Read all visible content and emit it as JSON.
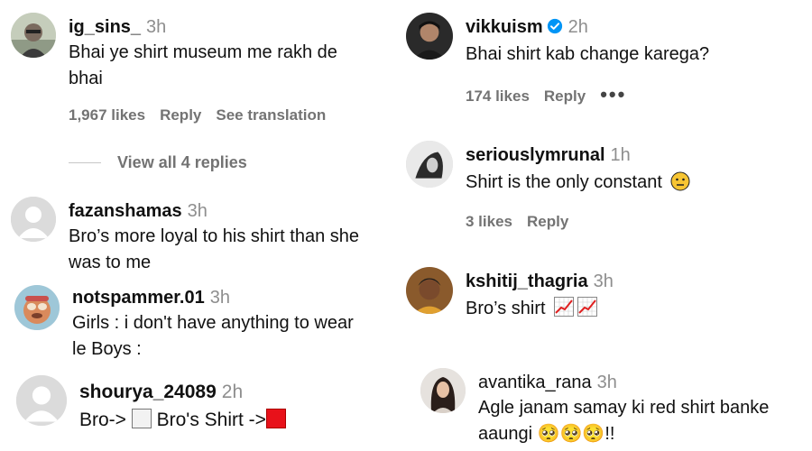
{
  "left": [
    {
      "username": "ig_sins_",
      "time": "3h",
      "text_line1": "Bhai ye shirt museum me rakh de",
      "text_line2": "bhai",
      "likes": "1,967 likes",
      "reply": "Reply",
      "see_translation": "See translation",
      "view_replies": "View all 4 replies"
    },
    {
      "username": "fazanshamas",
      "time": "3h",
      "text_line1": "Bro’s more loyal to his shirt than she",
      "text_line2": "was to me"
    },
    {
      "username": "notspammer.01",
      "time": "3h",
      "text_line1": "Girls : i don't have anything to wear",
      "text_line2": "le Boys :"
    },
    {
      "username": "shourya_24089",
      "time": "2h",
      "text_a": "Bro->",
      "text_b": "Bro's Shirt ->"
    }
  ],
  "right": [
    {
      "username": "vikkuism",
      "time": "2h",
      "text": "Bhai shirt kab change karega?",
      "likes": "174 likes",
      "reply": "Reply",
      "more": "•••"
    },
    {
      "username": "seriouslymrunal",
      "time": "1h",
      "text": "Shirt is the only constant",
      "likes": "3 likes",
      "reply": "Reply"
    },
    {
      "username": "kshitij_thagria",
      "time": "3h",
      "text": "Bro’s shirt"
    },
    {
      "username": "avantika_rana",
      "time": "3h",
      "text_line1": "Agle janam samay ki red shirt banke",
      "text_line2": "aaungi 🥺🥺🥺!!"
    }
  ],
  "colors": {
    "verified": "#0095f6",
    "muted": "#737373",
    "time": "#8e8e8e",
    "red_square": "#e8111a"
  },
  "icons": [
    "verified-badge-icon",
    "neutral-face-emoji",
    "chart-increasing-emoji",
    "white-square-icon",
    "red-square-icon",
    "more-options-icon"
  ]
}
